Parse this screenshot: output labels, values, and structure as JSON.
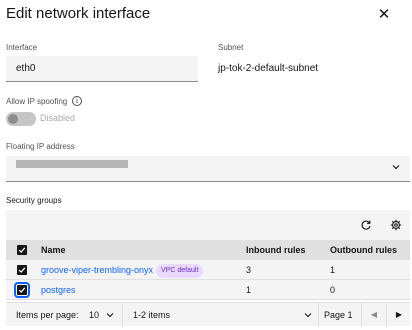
{
  "dialog": {
    "title": "Edit network interface",
    "close_icon": "close-icon"
  },
  "interface": {
    "label": "Interface",
    "value": "eth0"
  },
  "subnet": {
    "label": "Subnet",
    "value": "jp-tok-2-default-subnet"
  },
  "ip_spoofing": {
    "label": "Allow IP spoofing",
    "info_icon": "information-icon",
    "state": "Disabled",
    "enabled": false
  },
  "floating_ip": {
    "label": "Floating IP address"
  },
  "security_groups": {
    "label": "Security groups",
    "columns": [
      "Name",
      "Inbound rules",
      "Outbound rules"
    ],
    "rows": [
      {
        "name": "groove-viper-trembling-onyx",
        "tag": "VPC default",
        "inbound": "3",
        "outbound": "1",
        "selected": true
      },
      {
        "name": "postgres",
        "tag": "",
        "inbound": "1",
        "outbound": "0",
        "selected": true
      }
    ]
  },
  "pagination": {
    "items_per_page_label": "Items per page:",
    "items_per_page": "10",
    "range": "1-2 items",
    "page": "Page 1"
  }
}
